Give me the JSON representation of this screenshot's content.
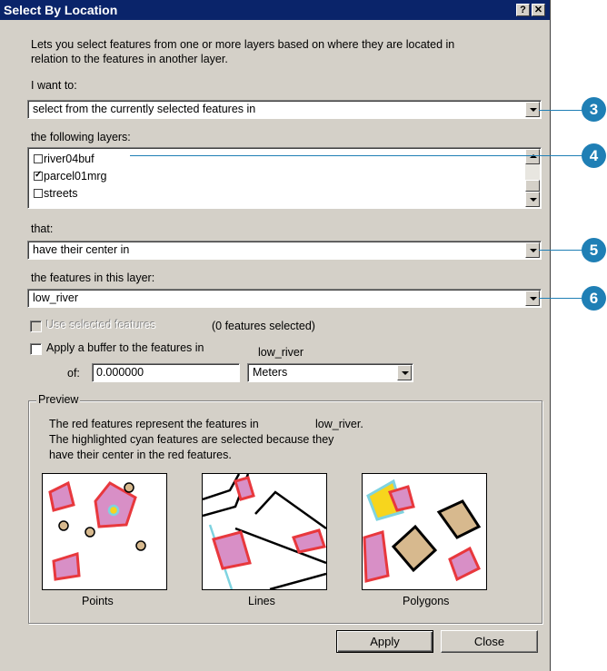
{
  "window": {
    "title": "Select By Location",
    "help_label": "?",
    "close_label": "✕"
  },
  "description": {
    "line1": "Lets you select features from one or more layers based on where they are located in",
    "line2": "relation to the features in another layer."
  },
  "method": {
    "label": "I want to:",
    "value": "select from the currently selected features in"
  },
  "layers": {
    "label": "the following layers:",
    "items": [
      {
        "name": "river04buf",
        "checked": false
      },
      {
        "name": "parcel01mrg",
        "checked": true
      },
      {
        "name": "streets",
        "checked": false
      }
    ]
  },
  "relation": {
    "label": "that:",
    "value": "have their center in"
  },
  "source_layer": {
    "label": "the features in this layer:",
    "value": "low_river"
  },
  "use_selected": {
    "label": "Use selected features",
    "count_text": "(0 features selected)"
  },
  "buffer": {
    "label": "Apply a buffer to the features in",
    "layer_name": "low_river",
    "of_label": "of:",
    "distance": "0.000000",
    "units": "Meters"
  },
  "preview": {
    "title": "Preview",
    "line1": "The red features represent the features in",
    "layer_name": "low_river.",
    "line2": "The highlighted cyan features are selected because they",
    "line3": "have their center in the red features.",
    "captions": [
      "Points",
      "Lines",
      "Polygons"
    ]
  },
  "buttons": {
    "apply": "Apply",
    "close": "Close"
  },
  "callouts": [
    "3",
    "4",
    "5",
    "6"
  ],
  "colors": {
    "red": "#e8383d",
    "fill": "#d88fc6",
    "cyan": "#7fd3e0",
    "tan": "#d7b98e",
    "yellow": "#f7d51d",
    "callout": "#1f7fb5"
  }
}
